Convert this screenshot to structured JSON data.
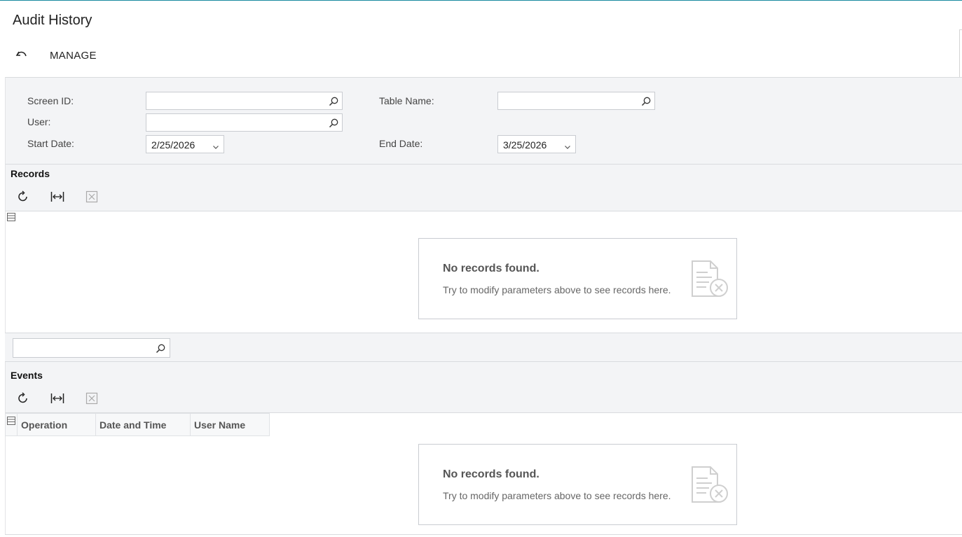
{
  "page": {
    "title": "Audit History",
    "manage_label": "MANAGE"
  },
  "filters": {
    "screen_id_label": "Screen ID:",
    "screen_id_value": "",
    "table_name_label": "Table Name:",
    "table_name_value": "",
    "user_label": "User:",
    "user_value": "",
    "start_date_label": "Start Date:",
    "start_date_value": "2/25/2026",
    "end_date_label": "End Date:",
    "end_date_value": "3/25/2026"
  },
  "records": {
    "title": "Records",
    "empty_title": "No records found.",
    "empty_sub": "Try to modify parameters above to see records here."
  },
  "search": {
    "value": ""
  },
  "events": {
    "title": "Events",
    "columns": [
      "Operation",
      "Date and Time",
      "User Name"
    ],
    "empty_title": "No records found.",
    "empty_sub": "Try to modify parameters above to see records here."
  },
  "colors": {
    "accent": "#1a8aa0",
    "panel_bg": "#f3f4f6",
    "border": "#c9ccd1"
  },
  "icons": [
    "undo-icon",
    "search-icon",
    "chevron-down-icon",
    "refresh-icon",
    "fit-columns-icon",
    "export-excel-icon",
    "row-selector-icon",
    "no-records-document-icon"
  ]
}
